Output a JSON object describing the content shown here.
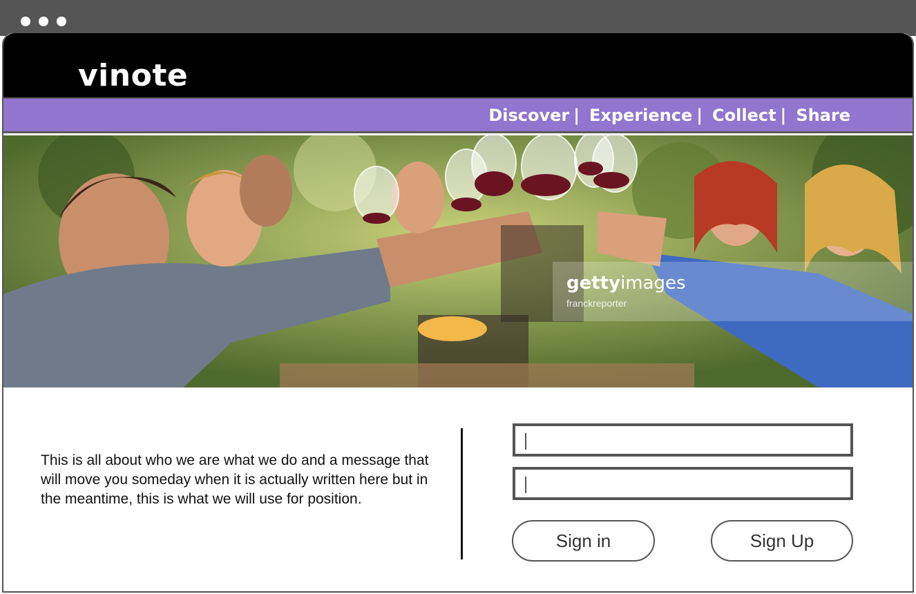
{
  "app": {
    "logo": "vinote"
  },
  "nav": {
    "items": [
      {
        "label": "Discover"
      },
      {
        "label": "Experience"
      },
      {
        "label": "Collect"
      },
      {
        "label": "Share"
      }
    ],
    "separator": "|"
  },
  "hero": {
    "watermark": {
      "brand_bold": "getty",
      "brand_rest": "images",
      "credit": "franckreporter"
    }
  },
  "about": {
    "text": "This is all about who we are what we do and a message that will move you someday when it is actually written here but in the meantime, this is what we will use for position."
  },
  "form": {
    "field1": {
      "value": "",
      "placeholder": ""
    },
    "field2": {
      "value": "",
      "placeholder": ""
    },
    "signin_label": "Sign in",
    "signup_label": "Sign Up"
  },
  "colors": {
    "header": "#000000",
    "nav": "#9175cf",
    "chrome": "#555555",
    "text": "#111111"
  }
}
